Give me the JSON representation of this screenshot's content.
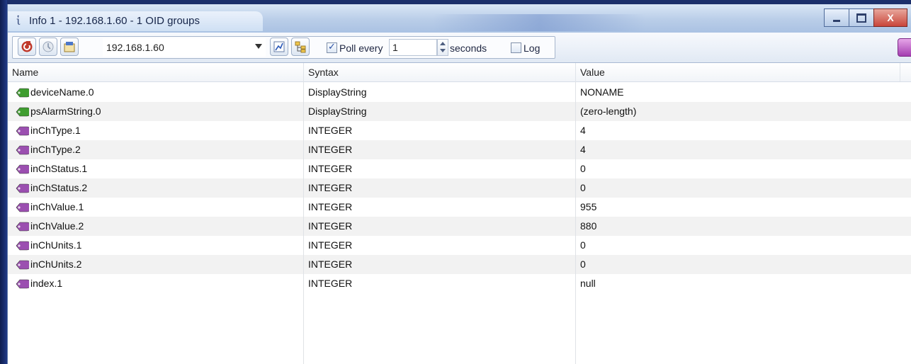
{
  "window": {
    "title": "Info 1  -  192.168.1.60  -  1 OID groups",
    "title_icon": "info-icon",
    "controls": [
      "minimize-icon",
      "maximize-icon",
      "close-icon"
    ],
    "close_glyph": "X"
  },
  "toolbar": {
    "ip_value": "192.168.1.60",
    "poll_label": "Poll every",
    "poll_checked": true,
    "poll_interval": "1",
    "seconds_label": "seconds",
    "log_label": "Log",
    "log_checked": false
  },
  "table": {
    "columns": [
      "Name",
      "Syntax",
      "Value"
    ],
    "rows": [
      {
        "name": "deviceName.0",
        "syntax": "DisplayString",
        "value": "NONAME",
        "icon": "green"
      },
      {
        "name": "psAlarmString.0",
        "syntax": "DisplayString",
        "value": "(zero-length)",
        "icon": "green"
      },
      {
        "name": "inChType.1",
        "syntax": "INTEGER",
        "value": "4",
        "icon": "purple"
      },
      {
        "name": "inChType.2",
        "syntax": "INTEGER",
        "value": "4",
        "icon": "purple"
      },
      {
        "name": "inChStatus.1",
        "syntax": "INTEGER",
        "value": "0",
        "icon": "purple"
      },
      {
        "name": "inChStatus.2",
        "syntax": "INTEGER",
        "value": "0",
        "icon": "purple"
      },
      {
        "name": "inChValue.1",
        "syntax": "INTEGER",
        "value": "955",
        "icon": "purple"
      },
      {
        "name": "inChValue.2",
        "syntax": "INTEGER",
        "value": "880",
        "icon": "purple"
      },
      {
        "name": "inChUnits.1",
        "syntax": "INTEGER",
        "value": "0",
        "icon": "purple"
      },
      {
        "name": "inChUnits.2",
        "syntax": "INTEGER",
        "value": "0",
        "icon": "purple"
      },
      {
        "name": "index.1",
        "syntax": "INTEGER",
        "value": "null",
        "icon": "purple"
      }
    ]
  },
  "colors": {
    "oid_green": "#3f9d2f",
    "oid_purple": "#9b4fb0",
    "alt_row": "#f2f2f2"
  }
}
